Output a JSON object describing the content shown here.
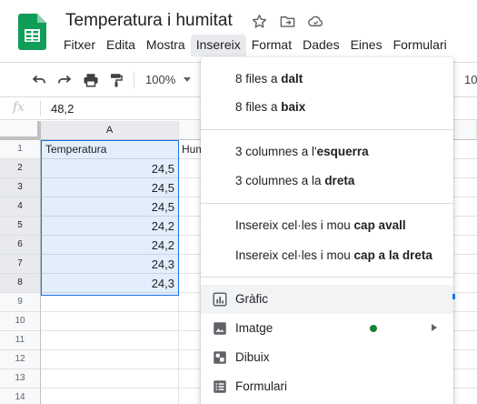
{
  "doc": {
    "title": "Temperatura i humitat"
  },
  "menubar": [
    "Fitxer",
    "Edita",
    "Mostra",
    "Insereix",
    "Format",
    "Dades",
    "Eines",
    "Formulari"
  ],
  "toolbar": {
    "zoom": "100%",
    "font_size": "10"
  },
  "formula_bar": {
    "fx": "fx",
    "value": "48,2"
  },
  "grid": {
    "col_headers": [
      "A"
    ],
    "row_numbers": [
      "1",
      "2",
      "3",
      "4",
      "5",
      "6",
      "7",
      "8",
      "9",
      "10",
      "11",
      "12",
      "13",
      "14"
    ],
    "header_row": {
      "a": "Temperatura",
      "b": "Hum"
    },
    "temperature_values": [
      "24,5",
      "24,5",
      "24,5",
      "24,2",
      "24,2",
      "24,3",
      "24,3"
    ]
  },
  "insert_menu": {
    "rows_above": {
      "pre": "8 files a ",
      "bold": "dalt"
    },
    "rows_below": {
      "pre": "8 files a ",
      "bold": "baix"
    },
    "cols_left": {
      "pre": "3 columnes a l'",
      "bold": "esquerra"
    },
    "cols_right": {
      "pre": "3 columnes a la ",
      "bold": "dreta"
    },
    "shift_down": {
      "pre": "Insereix cel·les i mou ",
      "bold": "cap avall"
    },
    "shift_right": {
      "pre": "Insereix cel·les i mou ",
      "bold": "cap a la dreta"
    },
    "chart": "Gràfic",
    "image": "Imatge",
    "drawing": "Dibuix",
    "form": "Formulari"
  },
  "colors": {
    "accent": "#1a73e8",
    "sheets_green": "#0f9d58",
    "new_dot": "#188038"
  }
}
